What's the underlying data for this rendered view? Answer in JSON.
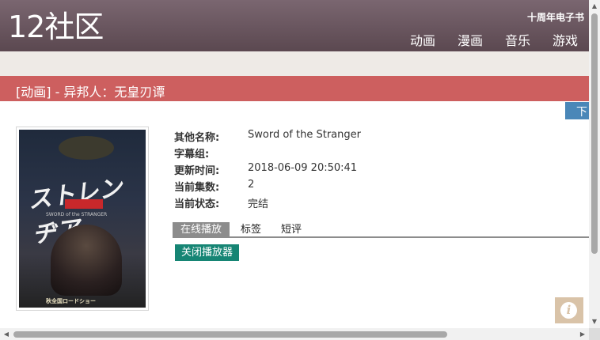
{
  "header": {
    "logo": "12社区",
    "anniversary_link": "十周年电子书",
    "nav": [
      "动画",
      "漫画",
      "音乐",
      "游戏"
    ]
  },
  "title_bar": {
    "text": "[动画] - 异邦人：无皇刃谭"
  },
  "download_tab": {
    "label": "下"
  },
  "poster": {
    "title_art": "ストレンヂア",
    "subtitle": "SWORD of the STRANGER",
    "bottom_text": "秋全国ロードショー"
  },
  "info": [
    {
      "key": "其他名称:",
      "value": "Sword of the Stranger"
    },
    {
      "key": "字幕组:",
      "value": ""
    },
    {
      "key": "更新时间:",
      "value": "2018-06-09 20:50:41"
    },
    {
      "key": "当前集数:",
      "value": "2"
    },
    {
      "key": "当前状态:",
      "value": "完结"
    }
  ],
  "tabs": [
    "在线播放",
    "标签",
    "短评"
  ],
  "close_player_button": "关闭播放器",
  "info_button": {
    "glyph": "i"
  },
  "scrollbars": {
    "up": "▲",
    "down": "▼",
    "left": "◀",
    "right": "▶"
  }
}
